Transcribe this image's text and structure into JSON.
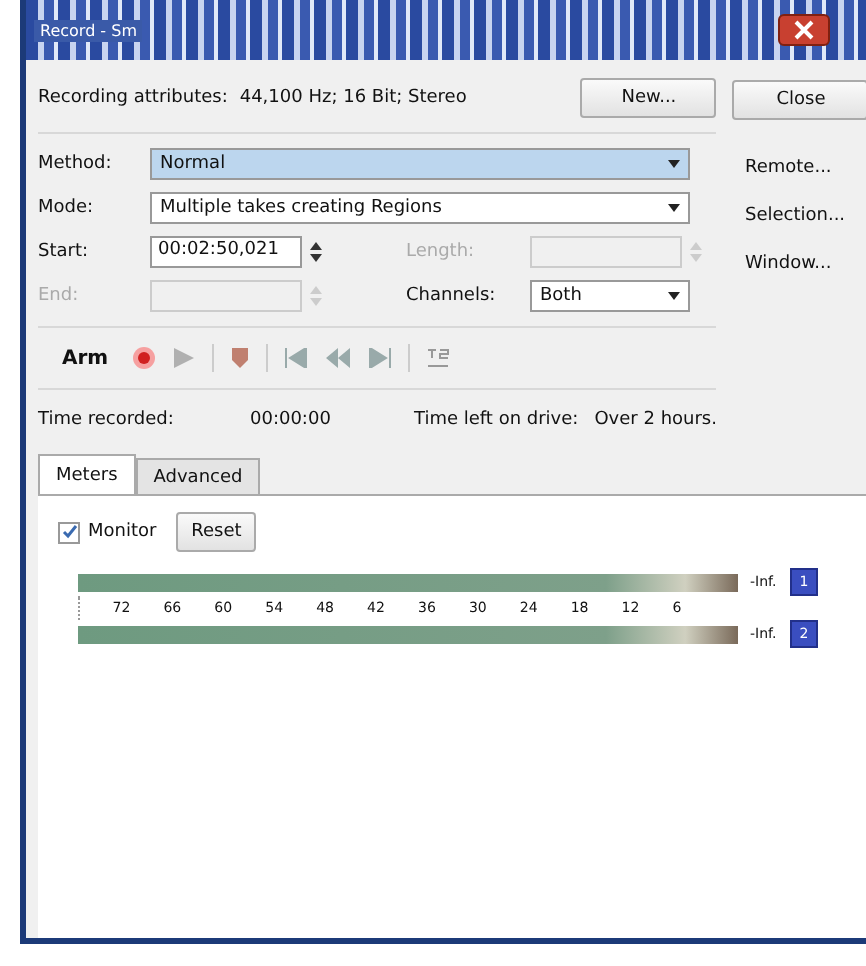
{
  "window": {
    "title": "Record - Sm"
  },
  "attributes": {
    "label": "Recording attributes:",
    "value": "44,100 Hz; 16 Bit; Stereo"
  },
  "side_buttons": [
    {
      "label": "New..."
    },
    {
      "label": "Close"
    },
    {
      "label": "Remote..."
    },
    {
      "label": "Selection..."
    },
    {
      "label": "Window..."
    }
  ],
  "method": {
    "label": "Method:",
    "value": "Normal"
  },
  "mode": {
    "label": "Mode:",
    "value": "Multiple takes creating Regions"
  },
  "start": {
    "label": "Start:",
    "value": "00:02:50,021",
    "disabled": false
  },
  "length": {
    "label": "Length:",
    "disabled": true
  },
  "end": {
    "label": "End:",
    "disabled": true
  },
  "channels": {
    "label": "Channels:",
    "value": "Both"
  },
  "transport": {
    "arm_label": "Arm"
  },
  "status": {
    "recorded_label": "Time recorded:",
    "recorded": "00:00:00",
    "left_label": "Time left on drive:",
    "left": "Over 2 hours."
  },
  "tabs": [
    {
      "label": "Meters",
      "selected": true
    },
    {
      "label": "Advanced",
      "selected": false
    }
  ],
  "monitor": {
    "label": "Monitor",
    "checked": true
  },
  "reset_button": "Reset",
  "meter": {
    "scale": [
      "72",
      "66",
      "60",
      "54",
      "48",
      "42",
      "36",
      "30",
      "24",
      "18",
      "12",
      "6"
    ],
    "channels": [
      {
        "peak": "-Inf.",
        "button": "1"
      },
      {
        "peak": "-Inf.",
        "button": "2"
      }
    ]
  }
}
